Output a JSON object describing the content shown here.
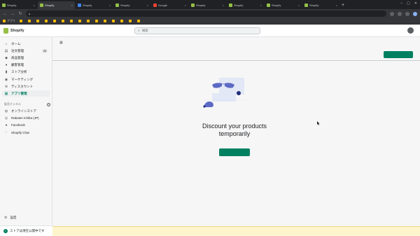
{
  "browser": {
    "tabs": [
      {
        "title": "Shopify",
        "favicon_color": "#95bf47",
        "active": false
      },
      {
        "title": "Shopify",
        "favicon_color": "#95bf47",
        "active": true
      },
      {
        "title": "Shopify",
        "favicon_color": "#4285f4",
        "active": false
      },
      {
        "title": "Shopify",
        "favicon_color": "#95bf47",
        "active": false
      },
      {
        "title": "Google",
        "favicon_color": "#ea4335",
        "active": false
      },
      {
        "title": "Shopify",
        "favicon_color": "#95bf47",
        "active": false
      },
      {
        "title": "Shopify",
        "favicon_color": "#95bf47",
        "active": false
      },
      {
        "title": "Shopify",
        "favicon_color": "#95bf47",
        "active": false
      },
      {
        "title": "Shopify",
        "favicon_color": "#95bf47",
        "active": false
      }
    ],
    "url": "",
    "bookmarks": [
      "アプリ",
      "",
      "",
      "",
      "",
      "",
      "",
      "",
      "",
      "",
      "",
      "",
      "",
      "",
      "",
      ""
    ]
  },
  "topbar": {
    "brand": "Shopify",
    "search_placeholder": "検索",
    "account_name": ""
  },
  "sidebar": {
    "items": [
      {
        "label": "ホーム",
        "icon": "home-icon",
        "glyph": "⌂"
      },
      {
        "label": "注文管理",
        "icon": "orders-icon",
        "glyph": "▤",
        "badge": "25"
      },
      {
        "label": "商品管理",
        "icon": "tag-icon",
        "glyph": "◆"
      },
      {
        "label": "顧客管理",
        "icon": "customer-icon",
        "glyph": "●"
      },
      {
        "label": "ストア分析",
        "icon": "analytics-icon",
        "glyph": "▮"
      },
      {
        "label": "マーケティング",
        "icon": "marketing-icon",
        "glyph": "◉"
      },
      {
        "label": "ディスカウント",
        "icon": "discount-icon",
        "glyph": "⊛"
      },
      {
        "label": "アプリ管理",
        "icon": "apps-icon",
        "glyph": "▦",
        "active": true
      }
    ],
    "sales_channels_heading": "販売チャネル",
    "channels": [
      {
        "label": "オンラインストア",
        "icon": "store-icon",
        "glyph": "◍"
      },
      {
        "label": "Rakuten Ichiba (JP)",
        "icon": "rakuten-icon",
        "glyph": "◎"
      },
      {
        "label": "Facebook",
        "icon": "facebook-icon",
        "glyph": "●"
      },
      {
        "label": "Shopify Chat",
        "icon": "chat-icon",
        "glyph": "◌"
      }
    ],
    "settings_label": "設定",
    "store_status": "ストアは現在公開中です"
  },
  "main": {
    "page_title": "",
    "by_line": "",
    "top_button": "",
    "empty_state": {
      "title_line1": "Discount your products",
      "title_line2": "temporarily",
      "description": "",
      "button": ""
    }
  },
  "banner": {
    "text": "",
    "link": ""
  },
  "colors": {
    "accent": "#008060",
    "brand": "#95bf47",
    "banner": "#fff5cc"
  }
}
